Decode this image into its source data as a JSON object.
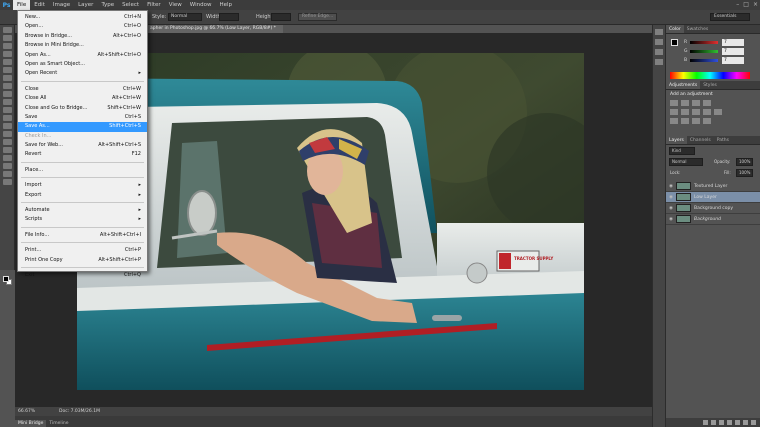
{
  "menubar": {
    "logo": "Ps",
    "items": [
      "File",
      "Edit",
      "Image",
      "Layer",
      "Type",
      "Select",
      "Filter",
      "View",
      "Window",
      "Help"
    ]
  },
  "options": {
    "style_label": "Style:",
    "style_value": "Normal",
    "width_label": "Width:",
    "height_label": "Height:",
    "refine_button": "Refine Edge...",
    "workspace": "Essentials"
  },
  "document": {
    "tab_title": "apher in Photoshop.jpg @ 66.7% (Low Layer, RGB/8#) *"
  },
  "file_menu": {
    "items": [
      {
        "label": "New...",
        "shortcut": "Ctrl+N"
      },
      {
        "label": "Open...",
        "shortcut": "Ctrl+O"
      },
      {
        "label": "Browse in Bridge...",
        "shortcut": "Alt+Ctrl+O"
      },
      {
        "label": "Browse in Mini Bridge...",
        "shortcut": ""
      },
      {
        "label": "Open As...",
        "shortcut": "Alt+Shift+Ctrl+O"
      },
      {
        "label": "Open as Smart Object...",
        "shortcut": ""
      },
      {
        "label": "Open Recent",
        "shortcut": "▸"
      },
      {
        "label": "Close",
        "shortcut": "Ctrl+W"
      },
      {
        "label": "Close All",
        "shortcut": "Alt+Ctrl+W"
      },
      {
        "label": "Close and Go to Bridge...",
        "shortcut": "Shift+Ctrl+W"
      },
      {
        "label": "Save",
        "shortcut": "Ctrl+S"
      },
      {
        "label": "Save As...",
        "shortcut": "Shift+Ctrl+S"
      },
      {
        "label": "Check In...",
        "shortcut": ""
      },
      {
        "label": "Save for Web...",
        "shortcut": "Alt+Shift+Ctrl+S"
      },
      {
        "label": "Revert",
        "shortcut": "F12"
      },
      {
        "label": "Place...",
        "shortcut": ""
      },
      {
        "label": "Import",
        "shortcut": "▸"
      },
      {
        "label": "Export",
        "shortcut": "▸"
      },
      {
        "label": "Automate",
        "shortcut": "▸"
      },
      {
        "label": "Scripts",
        "shortcut": "▸"
      },
      {
        "label": "File Info...",
        "shortcut": "Alt+Shift+Ctrl+I"
      },
      {
        "label": "Print...",
        "shortcut": "Ctrl+P"
      },
      {
        "label": "Print One Copy",
        "shortcut": "Alt+Shift+Ctrl+P"
      },
      {
        "label": "Exit",
        "shortcut": "Ctrl+Q"
      }
    ]
  },
  "status": {
    "zoom": "66.67%",
    "doc": "Doc: 7.03M/26.1M"
  },
  "bottom_tabs": [
    "Mini Bridge",
    "Timeline"
  ],
  "color_panel": {
    "tabs": [
      "Color",
      "Swatches"
    ],
    "channels": [
      {
        "name": "R",
        "value": "7",
        "color": "#e03030"
      },
      {
        "name": "G",
        "value": "7",
        "color": "#30c030"
      },
      {
        "name": "B",
        "value": "7",
        "color": "#3050e0"
      }
    ]
  },
  "adjustments_panel": {
    "tabs": [
      "Adjustments",
      "Styles"
    ],
    "title": "Add an adjustment"
  },
  "layers_panel": {
    "tabs": [
      "Layers",
      "Channels",
      "Paths"
    ],
    "kind": "Kind",
    "blend_mode": "Normal",
    "opacity_label": "Opacity:",
    "opacity": "100%",
    "lock_label": "Lock:",
    "fill_label": "Fill:",
    "fill": "100%",
    "layers": [
      {
        "name": "Textured Layer",
        "selected": false
      },
      {
        "name": "Low Layer",
        "selected": true
      },
      {
        "name": "Background copy",
        "selected": false
      },
      {
        "name": "Background",
        "selected": false
      }
    ]
  },
  "photo": {
    "badge_text": "TRACTOR SUPPLY"
  }
}
